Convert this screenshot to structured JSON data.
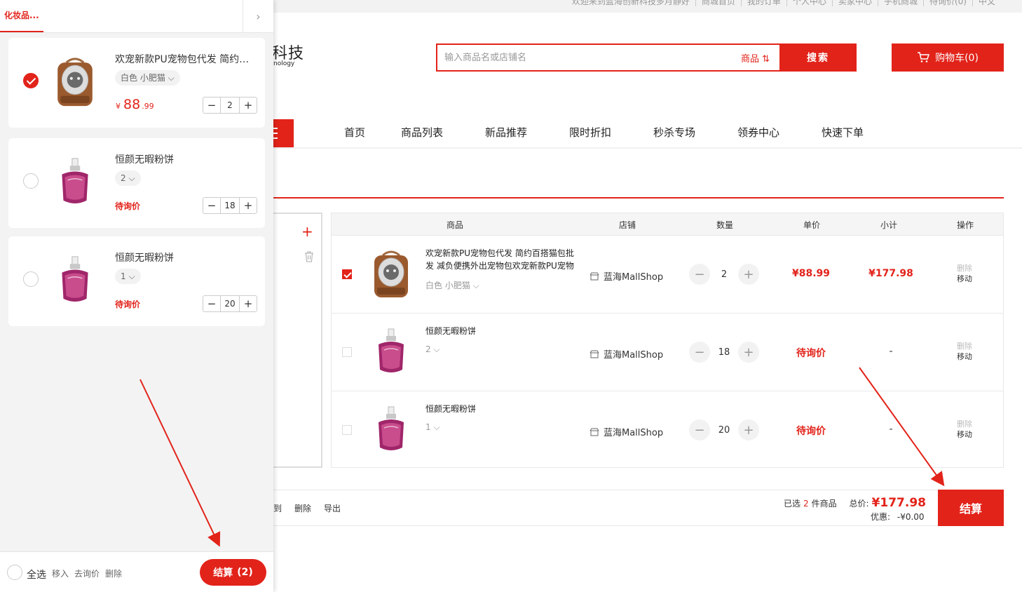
{
  "topbar": {
    "links": [
      "欢迎来到蓝海创新科技多月静好",
      "商城首页",
      "我的订单",
      "个人中心",
      "卖家中心",
      "手机商城",
      "待询价(0)",
      "中文"
    ]
  },
  "header": {
    "logo_text": "科技",
    "logo_sub": "nology",
    "search_placeholder": "输入商品名或店铺名",
    "search_type": "商品 ⇅",
    "search_button": "搜索",
    "cart_button": "购物车(0)"
  },
  "nav": {
    "items": [
      "首页",
      "商品列表",
      "新品推荐",
      "限时折扣",
      "秒杀专场",
      "领券中心",
      "快速下单"
    ]
  },
  "group_panel": {
    "add_symbol": "+"
  },
  "table": {
    "headers": [
      "商品",
      "店铺",
      "数量",
      "单价",
      "小计",
      "操作"
    ],
    "rows": [
      {
        "title": "欢宠新款PU宠物包代发 简约百搭猫包批发 减负便携外出宠物包欢宠新款PU宠物包",
        "spec": "白色 小肥猫 ⌵",
        "shop": "蓝海MallShop",
        "qty": "2",
        "minus": "−",
        "plus": "+",
        "price": "¥88.99",
        "subtotal": "¥177.98",
        "op_delete": "删除",
        "op_move": "移动",
        "checked": true
      },
      {
        "title": "恒颜无暇粉饼",
        "spec": "2 ⌵",
        "shop": "蓝海MallShop",
        "qty": "18",
        "minus": "−",
        "plus": "+",
        "price": "待询价",
        "subtotal": "-",
        "op_delete": "删除",
        "op_move": "移动",
        "checked": false
      },
      {
        "title": "恒颜无暇粉饼",
        "spec": "1 ⌵",
        "shop": "蓝海MallShop",
        "qty": "20",
        "minus": "−",
        "plus": "+",
        "price": "待询价",
        "subtotal": "-",
        "op_delete": "删除",
        "op_move": "移动",
        "checked": false
      }
    ]
  },
  "footer": {
    "actions": [
      "到",
      "删除",
      "导出"
    ],
    "selected_prefix": "已选",
    "selected_count": "2",
    "selected_suffix": "件商品",
    "total_label": "总价:",
    "total_value": "¥177.98",
    "discount_label": "优惠:",
    "discount_value": "-¥0.00",
    "checkout": "结算"
  },
  "drawer": {
    "tab": "化妆品...",
    "arrow": "›",
    "items": [
      {
        "title": "欢宠新款PU宠物包代发 简约百搭猫包批发",
        "spec": "白色 小肥猫 ⌵",
        "price_currency": "¥",
        "price_int": "88",
        "price_dec": ".99",
        "qty": "2",
        "minus": "−",
        "plus": "+",
        "checked": true
      },
      {
        "title": "恒颜无暇粉饼",
        "spec": "2 ⌵",
        "inquiry": "待询价",
        "qty": "18",
        "minus": "−",
        "plus": "+",
        "checked": false
      },
      {
        "title": "恒颜无暇粉饼",
        "spec": "1 ⌵",
        "inquiry": "待询价",
        "qty": "20",
        "minus": "−",
        "plus": "+",
        "checked": false
      }
    ],
    "footer": {
      "select_all": "全选",
      "actions": [
        "移入",
        "去询价",
        "删除"
      ],
      "checkout": "结算",
      "checkout_count": "(2)"
    }
  },
  "colors": {
    "accent": "#e2231a",
    "arrow": "#e2231a"
  }
}
